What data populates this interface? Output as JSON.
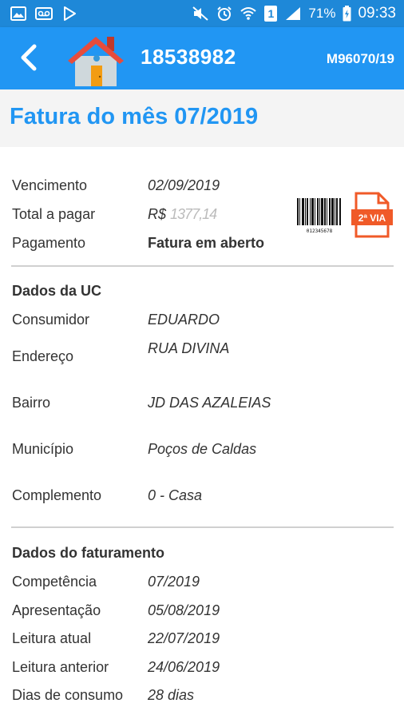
{
  "status_bar": {
    "battery": "71%",
    "time": "09:33",
    "sim_slot": "1",
    "icons": [
      "image-icon",
      "voicemail-icon",
      "play-store-icon",
      "mute-icon",
      "alarm-icon",
      "wifi-icon",
      "sim-icon",
      "signal-icon",
      "battery-icon"
    ]
  },
  "app_bar": {
    "back_icon": "back-arrow-icon",
    "house_icon": "house-icon",
    "uc_number": "18538982",
    "reference": "M96070/19"
  },
  "title": "Fatura do mês 07/2019",
  "invoice": {
    "due_label": "Vencimento",
    "due_value": "02/09/2019",
    "total_label": "Total a pagar",
    "total_currency": "R$",
    "total_value_obscured": "1377,14",
    "payment_label": "Pagamento",
    "payment_value": "Fatura em aberto",
    "barcode_icon": "barcode-icon",
    "barcode_number": "012345678",
    "second_copy_label": "2ª VIA"
  },
  "uc_section": {
    "heading": "Dados da UC",
    "consumer_label": "Consumidor",
    "consumer_value": "EDUARDO",
    "address_label": "Endereço",
    "address_value": "RUA DIVINA",
    "district_label": "Bairro",
    "district_value": "JD DAS AZALEIAS",
    "city_label": "Município",
    "city_value": "Poços de Caldas",
    "complement_label": "Complemento",
    "complement_value": "0 - Casa"
  },
  "billing_section": {
    "heading": "Dados do faturamento",
    "competence_label": "Competência",
    "competence_value": "07/2019",
    "presentation_label": "Apresentação",
    "presentation_value": "05/08/2019",
    "current_reading_label": "Leitura atual",
    "current_reading_value": "22/07/2019",
    "previous_reading_label": "Leitura anterior",
    "previous_reading_value": "24/06/2019",
    "consumption_days_label": "Dias de consumo",
    "consumption_days_value": "28 dias"
  },
  "colors": {
    "status_bar": "#1e88d8",
    "app_bar": "#2196f3",
    "title": "#2196f3",
    "pdf_orange": "#f05a28"
  }
}
